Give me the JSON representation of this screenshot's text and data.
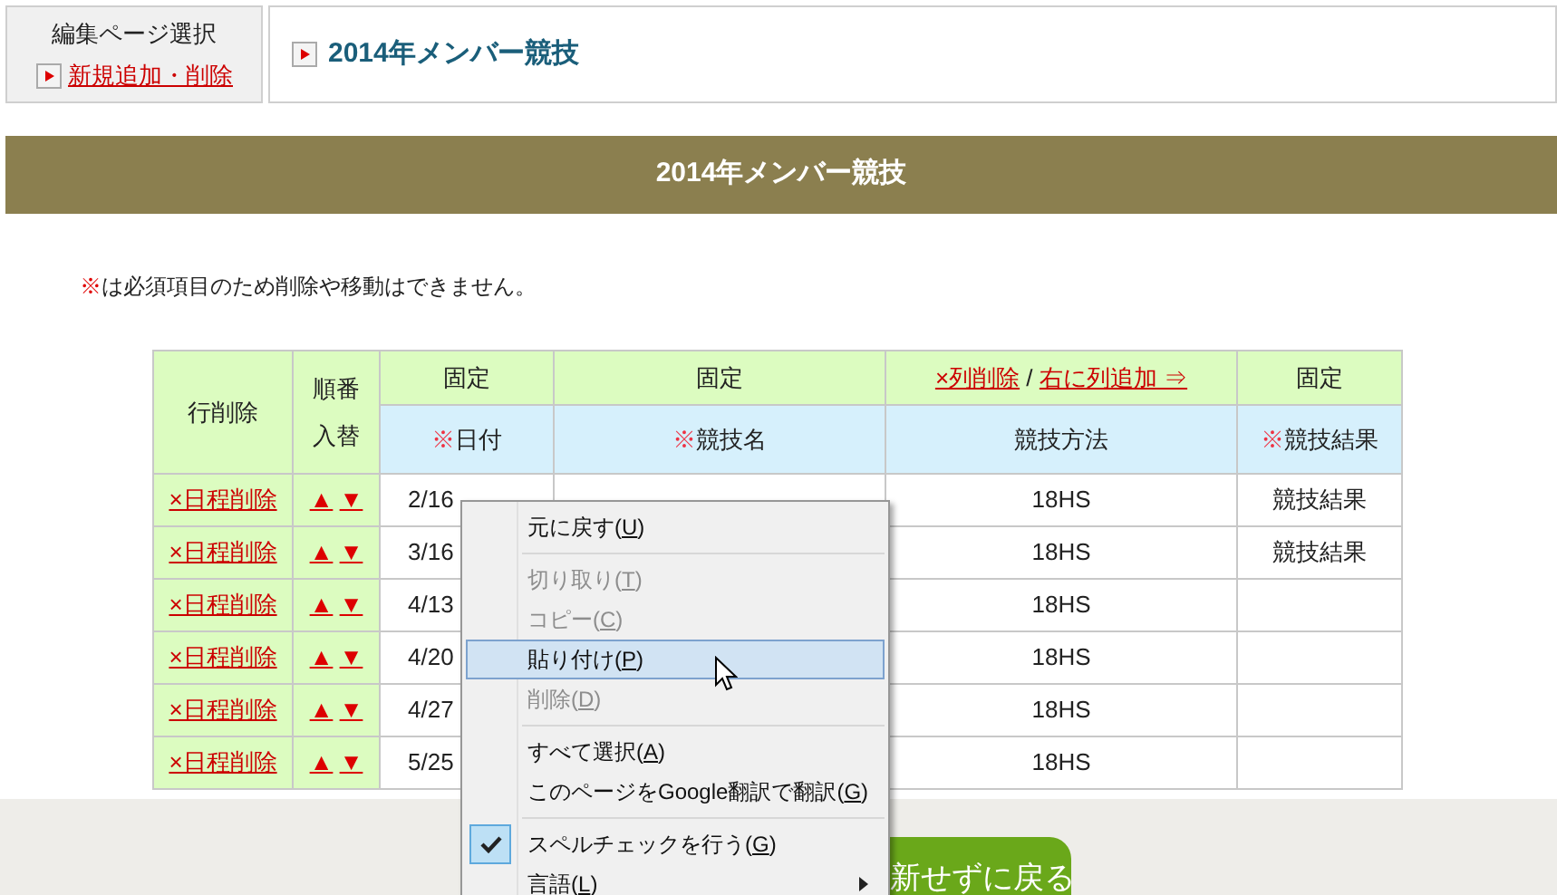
{
  "header": {
    "section_label": "編集ページ選択",
    "add_link": "新規追加・削除",
    "page_title": "2014年メンバー競技"
  },
  "banner_title": "2014年メンバー競技",
  "notice": {
    "mark": "※",
    "text": "は必須項目のため削除や移動はできません。"
  },
  "table": {
    "columns": [
      {
        "kind": "span",
        "lines": [
          "行削除"
        ]
      },
      {
        "kind": "span",
        "lines": [
          "順番",
          "入替"
        ]
      },
      {
        "kind": "fixed",
        "top": "固定",
        "mark": "※",
        "label": "日付"
      },
      {
        "kind": "fixed",
        "top": "固定",
        "mark": "※",
        "label": "競技名"
      },
      {
        "kind": "editable",
        "delete_link": "×列削除",
        "separator": "/",
        "add_link": "右に列追加 ⇒",
        "label": "競技方法"
      },
      {
        "kind": "fixed",
        "top": "固定",
        "mark": "※",
        "label": "競技結果"
      }
    ],
    "rows": [
      {
        "delete": "×日程削除",
        "up": "▲",
        "down": "▼",
        "date": "2/16",
        "method": "18HS",
        "result": "競技結果"
      },
      {
        "delete": "×日程削除",
        "up": "▲",
        "down": "▼",
        "date": "3/16",
        "method": "18HS",
        "result": "競技結果"
      },
      {
        "delete": "×日程削除",
        "up": "▲",
        "down": "▼",
        "date": "4/13",
        "method": "18HS"
      },
      {
        "delete": "×日程削除",
        "up": "▲",
        "down": "▼",
        "date": "4/20",
        "method": "18HS"
      },
      {
        "delete": "×日程削除",
        "up": "▲",
        "down": "▼",
        "date": "4/27",
        "method": "18HS"
      },
      {
        "delete": "×日程削除",
        "up": "▲",
        "down": "▼",
        "date": "5/25",
        "method": "18HS"
      }
    ]
  },
  "footer": {
    "back_button": "新せずに戻る"
  },
  "context_menu": [
    {
      "kind": "item",
      "text": "元に戻す(U)",
      "disabled": false,
      "selected": false,
      "checked": false,
      "submenu": false
    },
    {
      "kind": "separator"
    },
    {
      "kind": "item",
      "text": "切り取り(T)",
      "disabled": true,
      "selected": false,
      "checked": false,
      "submenu": false
    },
    {
      "kind": "item",
      "text": "コピー(C)",
      "disabled": true,
      "selected": false,
      "checked": false,
      "submenu": false
    },
    {
      "kind": "item",
      "text": "貼り付け(P)",
      "disabled": false,
      "selected": true,
      "checked": false,
      "submenu": false
    },
    {
      "kind": "item",
      "text": "削除(D)",
      "disabled": true,
      "selected": false,
      "checked": false,
      "submenu": false
    },
    {
      "kind": "separator"
    },
    {
      "kind": "item",
      "text": "すべて選択(A)",
      "disabled": false,
      "selected": false,
      "checked": false,
      "submenu": false
    },
    {
      "kind": "item",
      "text": "このページをGoogle翻訳で翻訳(G)",
      "disabled": false,
      "selected": false,
      "checked": false,
      "submenu": false
    },
    {
      "kind": "separator"
    },
    {
      "kind": "item",
      "text": "スペルチェックを行う(G)",
      "disabled": false,
      "selected": false,
      "checked": true,
      "submenu": false
    },
    {
      "kind": "item",
      "text": "言語(L)",
      "disabled": false,
      "selected": false,
      "checked": false,
      "submenu": true
    }
  ]
}
